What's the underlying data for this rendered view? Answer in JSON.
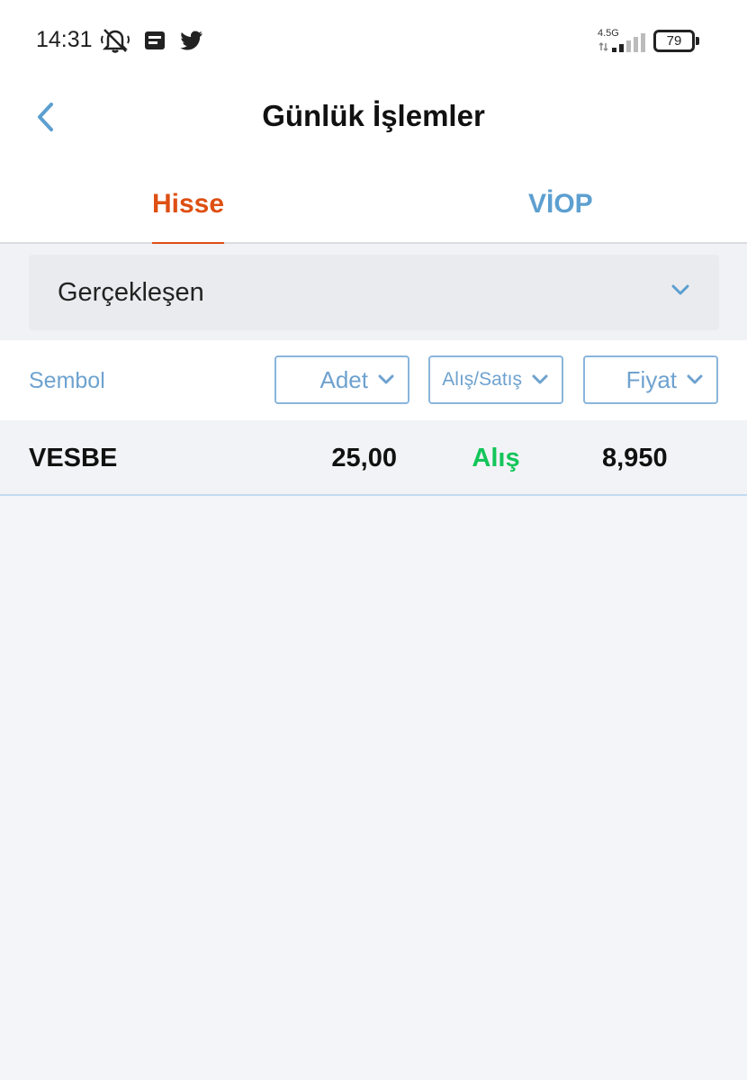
{
  "status_bar": {
    "time": "14:31",
    "network": "4.5G",
    "battery": "79",
    "icons": [
      "bell-off-icon",
      "notification-icon",
      "twitter-icon",
      "signal-icon",
      "battery-icon"
    ]
  },
  "header": {
    "title": "Günlük İşlemler",
    "back_icon": "chevron-left-icon"
  },
  "tabs": [
    {
      "label": "Hisse",
      "active": true
    },
    {
      "label": "VİOP",
      "active": false
    }
  ],
  "filter": {
    "selected": "Gerçekleşen",
    "icon": "chevron-down-icon"
  },
  "columns": {
    "symbol": "Sembol",
    "quantity": "Adet",
    "side": "Alış/Satış",
    "price": "Fiyat"
  },
  "rows": [
    {
      "symbol": "VESBE",
      "quantity": "25,00",
      "side": "Alış",
      "price": "8,950"
    }
  ],
  "colors": {
    "accent": "#de4f12",
    "link": "#5c9fd0",
    "buy": "#13c55a"
  }
}
